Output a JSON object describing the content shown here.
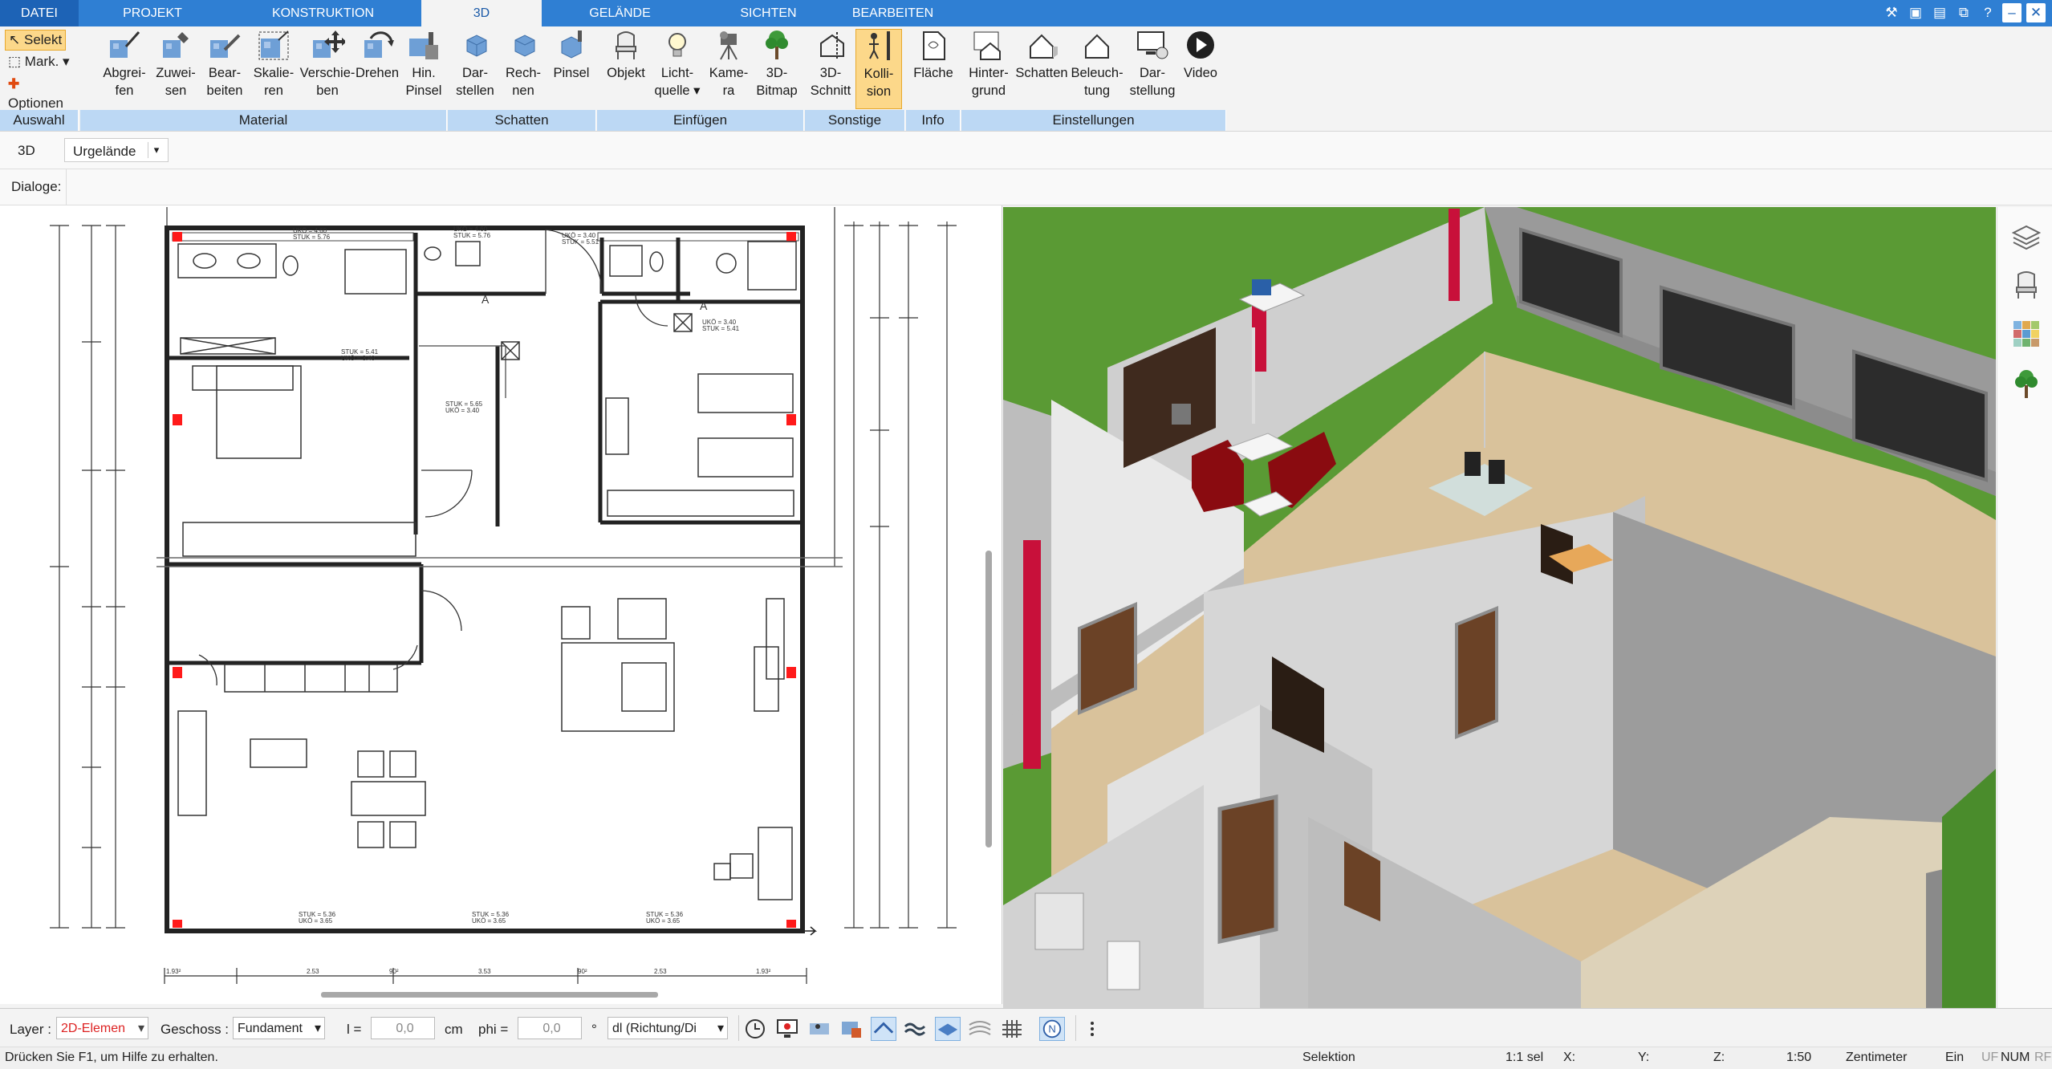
{
  "tabs": [
    {
      "label": "DATEI"
    },
    {
      "label": "PROJEKT"
    },
    {
      "label": "KONSTRUKTION"
    },
    {
      "label": "3D"
    },
    {
      "label": "GELÄNDE"
    },
    {
      "label": "SICHTEN"
    },
    {
      "label": "BEARBEITEN"
    }
  ],
  "selection_group": {
    "selekt": "Selekt",
    "mark": "Mark.",
    "optionen": "Optionen",
    "label": "Auswahl"
  },
  "ribbon_groups": [
    {
      "label": "Material",
      "buttons": [
        {
          "line1": "Abgrei-",
          "line2": "fen",
          "icon": "eyedropper-icon"
        },
        {
          "line1": "Zuwei-",
          "line2": "sen",
          "icon": "assign-material-icon"
        },
        {
          "line1": "Bear-",
          "line2": "beiten",
          "icon": "edit-material-icon"
        },
        {
          "line1": "Skalie-",
          "line2": "ren",
          "icon": "scale-icon"
        },
        {
          "line1": "Verschie-",
          "line2": "ben",
          "icon": "move-icon"
        },
        {
          "line1": "Drehen",
          "line2": "",
          "icon": "rotate-icon"
        },
        {
          "line1": "Hin.",
          "line2": "Pinsel",
          "icon": "brush-icon"
        }
      ]
    },
    {
      "label": "Schatten",
      "buttons": [
        {
          "line1": "Dar-",
          "line2": "stellen",
          "icon": "shadow-show-icon"
        },
        {
          "line1": "Rech-",
          "line2": "nen",
          "icon": "shadow-calc-icon"
        },
        {
          "line1": "Pinsel",
          "line2": "",
          "icon": "shadow-brush-icon"
        }
      ]
    },
    {
      "label": "Einfügen",
      "buttons": [
        {
          "line1": "Objekt",
          "line2": "",
          "icon": "chair-icon"
        },
        {
          "line1": "Licht-",
          "line2": "quelle ▾",
          "icon": "lightbulb-icon"
        },
        {
          "line1": "Kame-",
          "line2": "ra",
          "icon": "camera-icon"
        },
        {
          "line1": "3D-",
          "line2": "Bitmap",
          "icon": "tree-icon"
        }
      ]
    },
    {
      "label": "Sonstige",
      "buttons": [
        {
          "line1": "3D-",
          "line2": "Schnitt",
          "icon": "section-icon"
        },
        {
          "line1": "Kolli-",
          "line2": "sion",
          "icon": "collision-icon"
        }
      ]
    },
    {
      "label": "Info",
      "buttons": [
        {
          "line1": "Fläche",
          "line2": "",
          "icon": "area-icon"
        }
      ]
    },
    {
      "label": "Einstellungen",
      "buttons": [
        {
          "line1": "Hinter-",
          "line2": "grund",
          "icon": "background-icon"
        },
        {
          "line1": "Schatten",
          "line2": "",
          "icon": "shadow-house-icon"
        },
        {
          "line1": "Beleuch-",
          "line2": "tung",
          "icon": "lighting-house-icon"
        },
        {
          "line1": "Dar-",
          "line2": "stellung",
          "icon": "display-settings-icon"
        },
        {
          "line1": "Video",
          "line2": "",
          "icon": "play-icon"
        }
      ]
    }
  ],
  "row1": {
    "view_label": "3D",
    "terrain_value": "Urgelände"
  },
  "row2": {
    "dialoge_label": "Dialoge:"
  },
  "bottom_toolbar": {
    "layer_label": "Layer :",
    "layer_value": "2D-Elemen",
    "geschoss_label": "Geschoss :",
    "geschoss_value": "Fundament",
    "l_label": "l =",
    "l_value": "0,0",
    "l_unit": "cm",
    "phi_label": "phi =",
    "phi_value": "0,0",
    "phi_unit": "°",
    "direction_value": "dl (Richtung/Di"
  },
  "status": {
    "hint": "Drücken Sie F1, um Hilfe zu erhalten.",
    "mode": "Selektion",
    "sel": "1:1 sel",
    "x": "X:",
    "y": "Y:",
    "z": "Z:",
    "scale": "1:50",
    "unit": "Zentimeter",
    "ein": "Ein",
    "uf": "UF",
    "num": "NUM",
    "rf": "RF"
  },
  "plan_labels": {
    "dim_top_left": "UKÖ = 4.60\nSTUK = 5.76",
    "dim_a": "A",
    "dim_b": "A"
  },
  "colors": {
    "accent": "#2f7fd3",
    "ribbon_group": "#bcd8f4",
    "active_button": "#fcd88a",
    "floor": "#d8c29c",
    "wall": "#cfcfcf",
    "grass": "#5a9a34",
    "red_marker": "#ff1a1a",
    "crimson": "#c8103a"
  }
}
